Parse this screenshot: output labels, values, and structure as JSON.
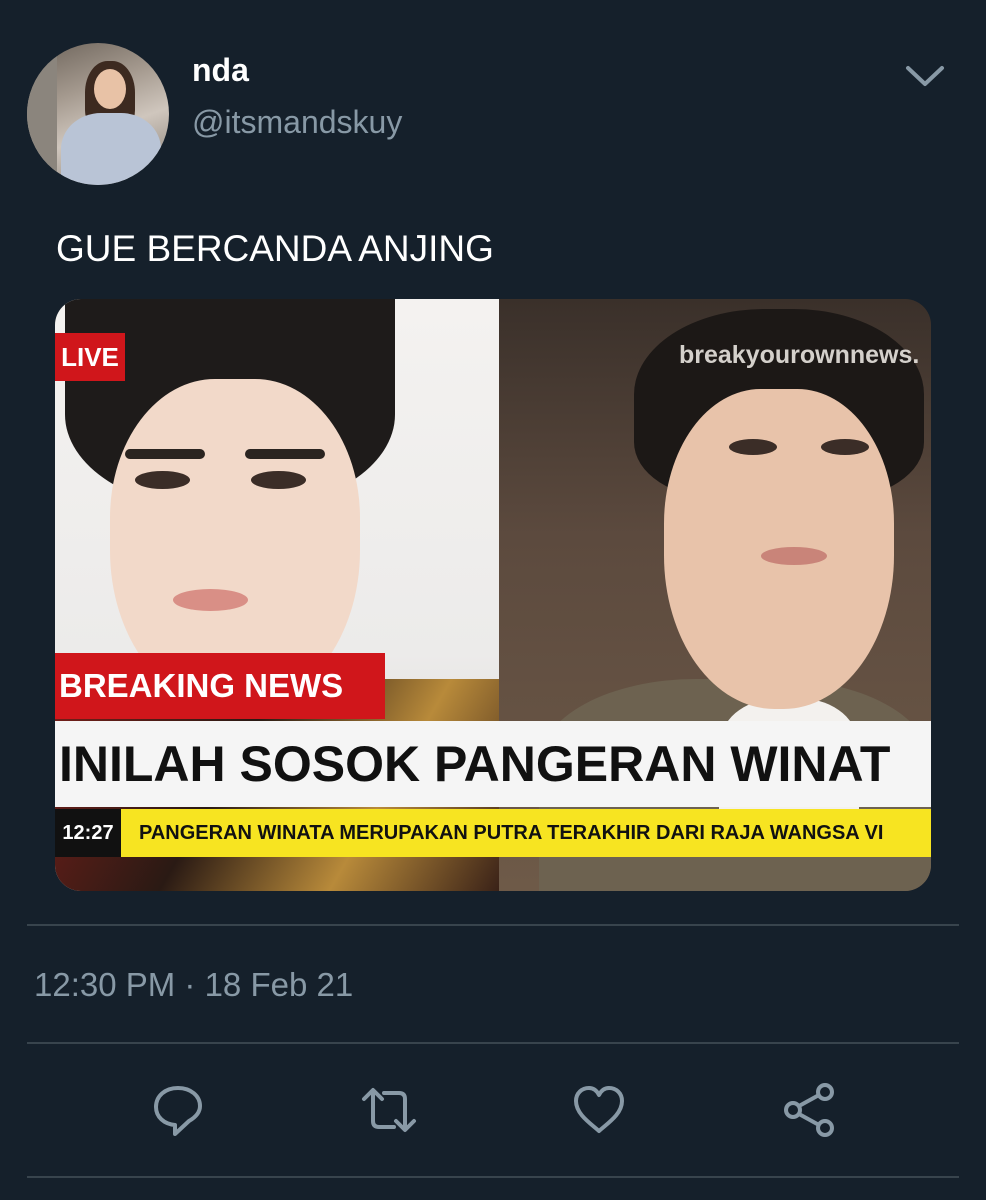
{
  "user": {
    "display_name": "nda",
    "handle": "@itsmandskuy"
  },
  "tweet": {
    "text": "GUE BERCANDA ANJING",
    "timestamp": "12:30 PM · 18 Feb 21"
  },
  "media": {
    "live_label": "LIVE",
    "watermark": "breakyourownnews.",
    "breaking_label": "BREAKING NEWS",
    "headline": "INILAH SOSOK PANGERAN WINAT",
    "ticker_time": "12:27",
    "ticker_text": "PANGERAN WINATA MERUPAKAN PUTRA TERAKHIR DARI RAJA WANGSA VI"
  },
  "actions": [
    {
      "name": "reply-icon"
    },
    {
      "name": "retweet-icon"
    },
    {
      "name": "like-icon"
    },
    {
      "name": "share-icon"
    }
  ],
  "colors": {
    "background": "#15202b",
    "secondary_text": "#8899a6",
    "breaking_red": "#d0161b",
    "ticker_yellow": "#f7e421"
  }
}
